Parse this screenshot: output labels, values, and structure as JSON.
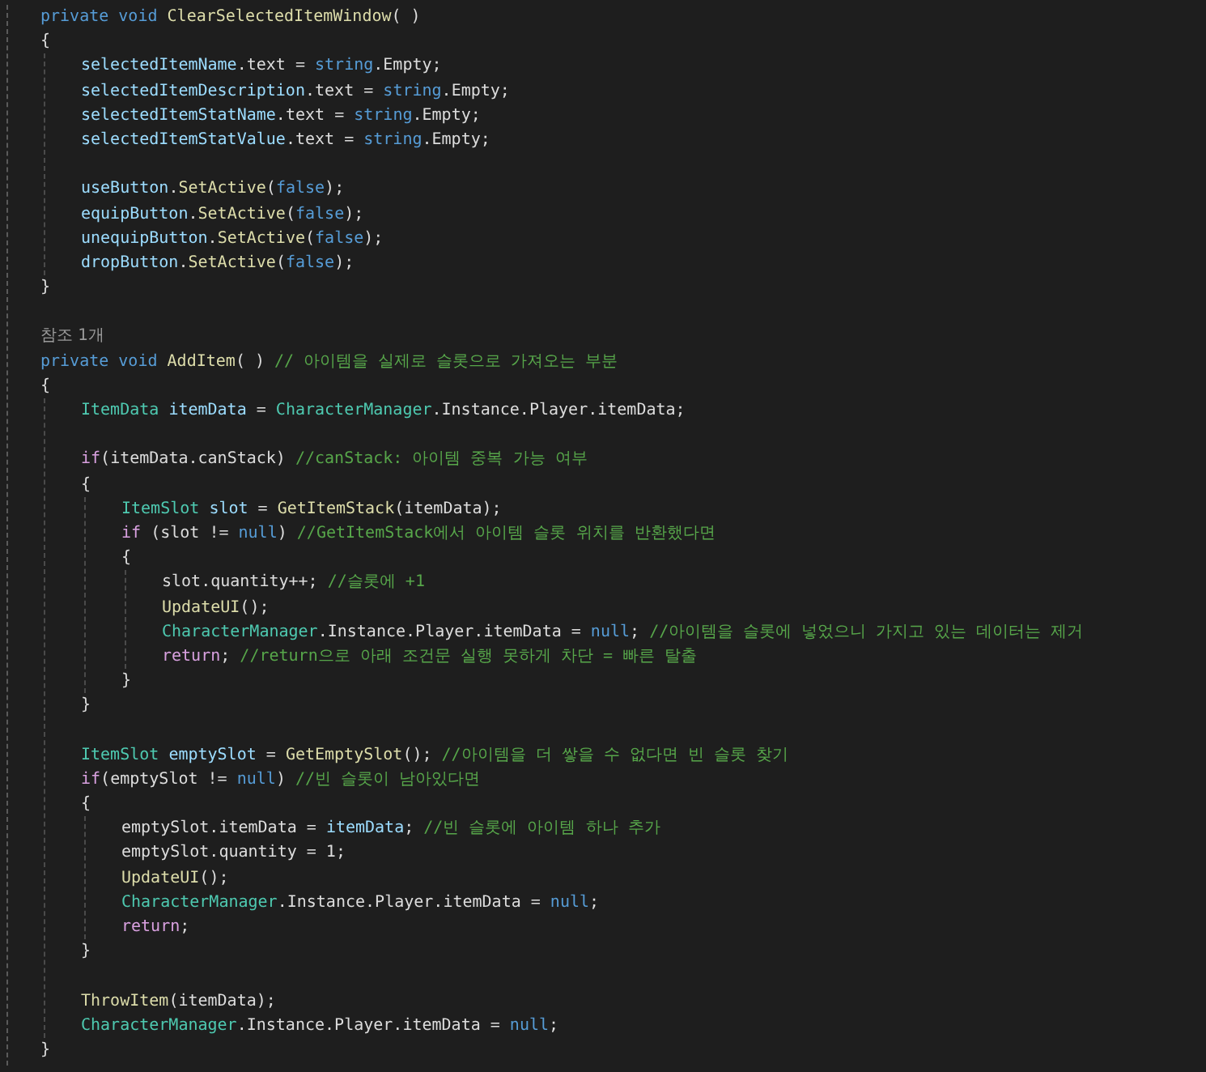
{
  "editor": {
    "lines": [
      {
        "tokens": [
          {
            "kind": "keyword",
            "text": "private void "
          },
          {
            "kind": "method",
            "text": "ClearSelectedItemWindow"
          },
          {
            "kind": "plain",
            "text": "( )"
          }
        ]
      },
      {
        "tokens": [
          {
            "kind": "plain",
            "text": "{"
          }
        ],
        "children": [
          {
            "tokens": [
              {
                "kind": "variable",
                "text": "selectedItemName"
              },
              {
                "kind": "plain",
                "text": "."
              },
              {
                "kind": "property",
                "text": "text"
              },
              {
                "kind": "plain",
                "text": " = "
              },
              {
                "kind": "keyword",
                "text": "string"
              },
              {
                "kind": "plain",
                "text": ".Empty;"
              }
            ]
          },
          {
            "tokens": [
              {
                "kind": "variable",
                "text": "selectedItemDescription"
              },
              {
                "kind": "plain",
                "text": "."
              },
              {
                "kind": "property",
                "text": "text"
              },
              {
                "kind": "plain",
                "text": " = "
              },
              {
                "kind": "keyword",
                "text": "string"
              },
              {
                "kind": "plain",
                "text": ".Empty;"
              }
            ]
          },
          {
            "tokens": [
              {
                "kind": "variable",
                "text": "selectedItemStatName"
              },
              {
                "kind": "plain",
                "text": "."
              },
              {
                "kind": "property",
                "text": "text"
              },
              {
                "kind": "plain",
                "text": " = "
              },
              {
                "kind": "keyword",
                "text": "string"
              },
              {
                "kind": "plain",
                "text": ".Empty;"
              }
            ]
          },
          {
            "tokens": [
              {
                "kind": "variable",
                "text": "selectedItemStatValue"
              },
              {
                "kind": "plain",
                "text": "."
              },
              {
                "kind": "property",
                "text": "text"
              },
              {
                "kind": "plain",
                "text": " = "
              },
              {
                "kind": "keyword",
                "text": "string"
              },
              {
                "kind": "plain",
                "text": ".Empty;"
              }
            ]
          },
          {
            "space_before": true,
            "tokens": [
              {
                "kind": "variable",
                "text": "useButton"
              },
              {
                "kind": "plain",
                "text": "."
              },
              {
                "kind": "method",
                "text": "SetActive"
              },
              {
                "kind": "plain",
                "text": "("
              },
              {
                "kind": "keyword",
                "text": "false"
              },
              {
                "kind": "plain",
                "text": ");"
              }
            ]
          },
          {
            "tokens": [
              {
                "kind": "variable",
                "text": "equipButton"
              },
              {
                "kind": "plain",
                "text": "."
              },
              {
                "kind": "method",
                "text": "SetActive"
              },
              {
                "kind": "plain",
                "text": "("
              },
              {
                "kind": "keyword",
                "text": "false"
              },
              {
                "kind": "plain",
                "text": ");"
              }
            ]
          },
          {
            "tokens": [
              {
                "kind": "variable",
                "text": "unequipButton"
              },
              {
                "kind": "plain",
                "text": "."
              },
              {
                "kind": "method",
                "text": "SetActive"
              },
              {
                "kind": "plain",
                "text": "("
              },
              {
                "kind": "keyword",
                "text": "false"
              },
              {
                "kind": "plain",
                "text": ");"
              }
            ]
          },
          {
            "tokens": [
              {
                "kind": "variable",
                "text": "dropButton"
              },
              {
                "kind": "plain",
                "text": "."
              },
              {
                "kind": "method",
                "text": "SetActive"
              },
              {
                "kind": "plain",
                "text": "("
              },
              {
                "kind": "keyword",
                "text": "false"
              },
              {
                "kind": "plain",
                "text": ");"
              }
            ]
          }
        ]
      },
      {
        "tokens": [
          {
            "kind": "plain",
            "text": "}"
          }
        ]
      },
      {
        "space_before": true,
        "tokens": [
          {
            "kind": "codelens",
            "text": "참조 1개"
          }
        ]
      },
      {
        "tokens": [
          {
            "kind": "keyword",
            "text": "private void "
          },
          {
            "kind": "method",
            "text": "AddItem"
          },
          {
            "kind": "plain",
            "text": "( ) "
          },
          {
            "kind": "comment",
            "text": "// 아이템을 실제로 슬롯으로 가져오는 부분"
          }
        ]
      },
      {
        "tokens": [
          {
            "kind": "plain",
            "text": "{"
          }
        ],
        "children": [
          {
            "tokens": [
              {
                "kind": "type",
                "text": "ItemData "
              },
              {
                "kind": "variable",
                "text": "itemData"
              },
              {
                "kind": "plain",
                "text": " = "
              },
              {
                "kind": "type",
                "text": "CharacterManager"
              },
              {
                "kind": "plain",
                "text": ".Instance."
              },
              {
                "kind": "property",
                "text": "Player"
              },
              {
                "kind": "plain",
                "text": ".itemData;"
              }
            ]
          },
          {
            "space_before": true,
            "tokens": [
              {
                "kind": "control",
                "text": "if"
              },
              {
                "kind": "plain",
                "text": "(itemData.canStack) "
              },
              {
                "kind": "comment",
                "text": "//canStack: 아이템 중복 가능 여부"
              }
            ]
          },
          {
            "tokens": [
              {
                "kind": "plain",
                "text": "{"
              }
            ],
            "children": [
              {
                "tokens": [
                  {
                    "kind": "type",
                    "text": "ItemSlot "
                  },
                  {
                    "kind": "variable",
                    "text": "slot"
                  },
                  {
                    "kind": "plain",
                    "text": " = "
                  },
                  {
                    "kind": "method",
                    "text": "GetItemStack"
                  },
                  {
                    "kind": "plain",
                    "text": "(itemData);"
                  }
                ]
              },
              {
                "tokens": [
                  {
                    "kind": "control",
                    "text": "if"
                  },
                  {
                    "kind": "plain",
                    "text": " (slot != "
                  },
                  {
                    "kind": "keyword",
                    "text": "null"
                  },
                  {
                    "kind": "plain",
                    "text": ") "
                  },
                  {
                    "kind": "comment",
                    "text": "//GetItemStack에서 아이템 슬롯 위치를 반환했다면"
                  }
                ]
              },
              {
                "tokens": [
                  {
                    "kind": "plain",
                    "text": "{"
                  }
                ],
                "children": [
                  {
                    "tokens": [
                      {
                        "kind": "plain",
                        "text": "slot.quantity++; "
                      },
                      {
                        "kind": "comment",
                        "text": "//슬롯에 +1"
                      }
                    ]
                  },
                  {
                    "tokens": [
                      {
                        "kind": "method",
                        "text": "UpdateUI"
                      },
                      {
                        "kind": "plain",
                        "text": "();"
                      }
                    ]
                  },
                  {
                    "tokens": [
                      {
                        "kind": "type",
                        "text": "CharacterManager"
                      },
                      {
                        "kind": "plain",
                        "text": ".Instance."
                      },
                      {
                        "kind": "property",
                        "text": "Player"
                      },
                      {
                        "kind": "plain",
                        "text": ".itemData = "
                      },
                      {
                        "kind": "keyword",
                        "text": "null"
                      },
                      {
                        "kind": "plain",
                        "text": "; "
                      },
                      {
                        "kind": "comment",
                        "text": "//아이템을 슬롯에 넣었으니 가지고 있는 데이터는 제거"
                      }
                    ]
                  },
                  {
                    "tokens": [
                      {
                        "kind": "control",
                        "text": "return"
                      },
                      {
                        "kind": "plain",
                        "text": "; "
                      },
                      {
                        "kind": "comment",
                        "text": "//return으로 아래 조건문 실행 못하게 차단 = 빠른 탈출"
                      }
                    ]
                  }
                ]
              },
              {
                "tokens": [
                  {
                    "kind": "plain",
                    "text": "}"
                  }
                ]
              }
            ]
          },
          {
            "tokens": [
              {
                "kind": "plain",
                "text": "}"
              }
            ]
          },
          {
            "space_before": true,
            "tokens": [
              {
                "kind": "type",
                "text": "ItemSlot "
              },
              {
                "kind": "variable",
                "text": "emptySlot"
              },
              {
                "kind": "plain",
                "text": " = "
              },
              {
                "kind": "method",
                "text": "GetEmptySlot"
              },
              {
                "kind": "plain",
                "text": "(); "
              },
              {
                "kind": "comment",
                "text": "//아이템을 더 쌓을 수 없다면 빈 슬롯 찾기"
              }
            ]
          },
          {
            "tokens": [
              {
                "kind": "control",
                "text": "if"
              },
              {
                "kind": "plain",
                "text": "(emptySlot != "
              },
              {
                "kind": "keyword",
                "text": "null"
              },
              {
                "kind": "plain",
                "text": ") "
              },
              {
                "kind": "comment",
                "text": "//빈 슬롯이 남아있다면"
              }
            ]
          },
          {
            "tokens": [
              {
                "kind": "plain",
                "text": "{"
              }
            ],
            "children": [
              {
                "tokens": [
                  {
                    "kind": "plain",
                    "text": "emptySlot.itemData = "
                  },
                  {
                    "kind": "variable",
                    "text": "itemData"
                  },
                  {
                    "kind": "plain",
                    "text": "; "
                  },
                  {
                    "kind": "comment",
                    "text": "//빈 슬롯에 아이템 하나 추가"
                  }
                ]
              },
              {
                "tokens": [
                  {
                    "kind": "plain",
                    "text": "emptySlot.quantity = 1;"
                  }
                ]
              },
              {
                "tokens": [
                  {
                    "kind": "method",
                    "text": "UpdateUI"
                  },
                  {
                    "kind": "plain",
                    "text": "();"
                  }
                ]
              },
              {
                "tokens": [
                  {
                    "kind": "type",
                    "text": "CharacterManager"
                  },
                  {
                    "kind": "plain",
                    "text": ".Instance."
                  },
                  {
                    "kind": "property",
                    "text": "Player"
                  },
                  {
                    "kind": "plain",
                    "text": ".itemData = "
                  },
                  {
                    "kind": "keyword",
                    "text": "null"
                  },
                  {
                    "kind": "plain",
                    "text": ";"
                  }
                ]
              },
              {
                "tokens": [
                  {
                    "kind": "control",
                    "text": "return"
                  },
                  {
                    "kind": "plain",
                    "text": ";"
                  }
                ]
              }
            ]
          },
          {
            "tokens": [
              {
                "kind": "plain",
                "text": "}"
              }
            ]
          },
          {
            "space_before": true,
            "tokens": [
              {
                "kind": "method",
                "text": "ThrowItem"
              },
              {
                "kind": "plain",
                "text": "(itemData);"
              }
            ]
          },
          {
            "tokens": [
              {
                "kind": "type",
                "text": "CharacterManager"
              },
              {
                "kind": "plain",
                "text": ".Instance."
              },
              {
                "kind": "property",
                "text": "Player"
              },
              {
                "kind": "plain",
                "text": ".itemData = "
              },
              {
                "kind": "keyword",
                "text": "null"
              },
              {
                "kind": "plain",
                "text": ";"
              }
            ]
          }
        ]
      },
      {
        "tokens": [
          {
            "kind": "plain",
            "text": "}"
          }
        ]
      }
    ]
  }
}
